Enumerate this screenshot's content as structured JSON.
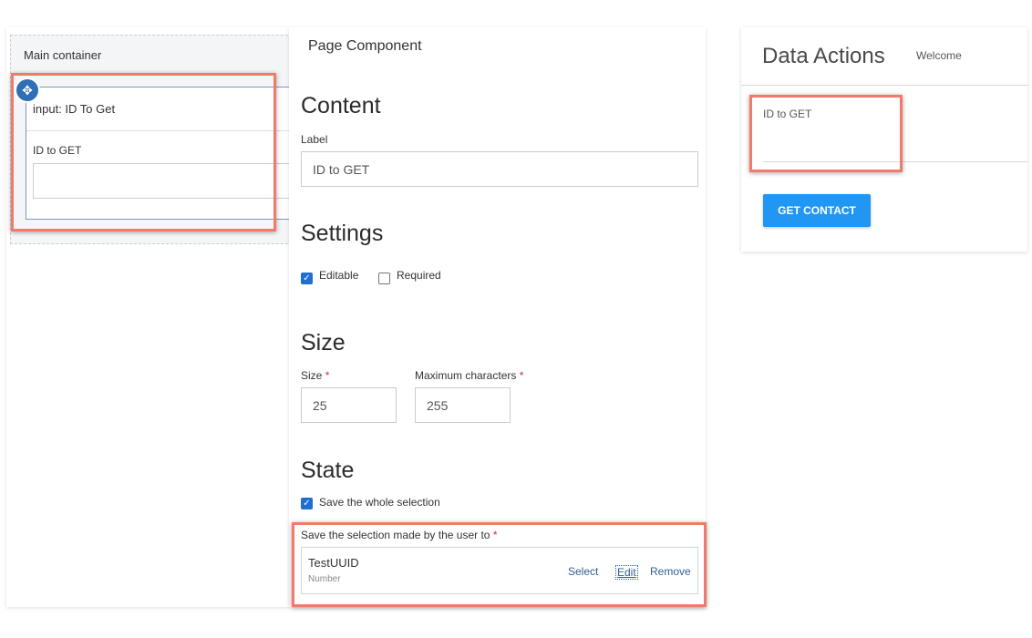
{
  "left": {
    "container_title": "Main container",
    "input_title": "input: ID To Get",
    "field_label": "ID to GET"
  },
  "middle": {
    "panel_title": "Page Component",
    "content": {
      "heading": "Content",
      "label_label": "Label",
      "label_value": "ID to GET"
    },
    "settings": {
      "heading": "Settings",
      "editable_label": "Editable",
      "editable_checked": true,
      "required_label": "Required",
      "required_checked": false
    },
    "size": {
      "heading": "Size",
      "size_label": "Size",
      "size_value": "25",
      "max_label": "Maximum characters",
      "max_value": "255",
      "required_mark": "*"
    },
    "state": {
      "heading": "State",
      "save_whole_label": "Save the whole selection",
      "save_whole_checked": true,
      "save_to_label": "Save the selection made by the user to",
      "variable_name": "TestUUID",
      "variable_type": "Number",
      "select_label": "Select",
      "edit_label": "Edit",
      "remove_label": "Remove"
    }
  },
  "right": {
    "title": "Data Actions",
    "welcome": "Welcome",
    "field_label": "ID to GET",
    "button_label": "GET CONTACT",
    "button_color": "#2196f3"
  },
  "colors": {
    "highlight": "#f07b6a",
    "checkbox": "#1f6fd1",
    "handle": "#2f6fb5"
  },
  "icons": {
    "move_handle": "move-icon",
    "checkmark": "check-icon"
  }
}
